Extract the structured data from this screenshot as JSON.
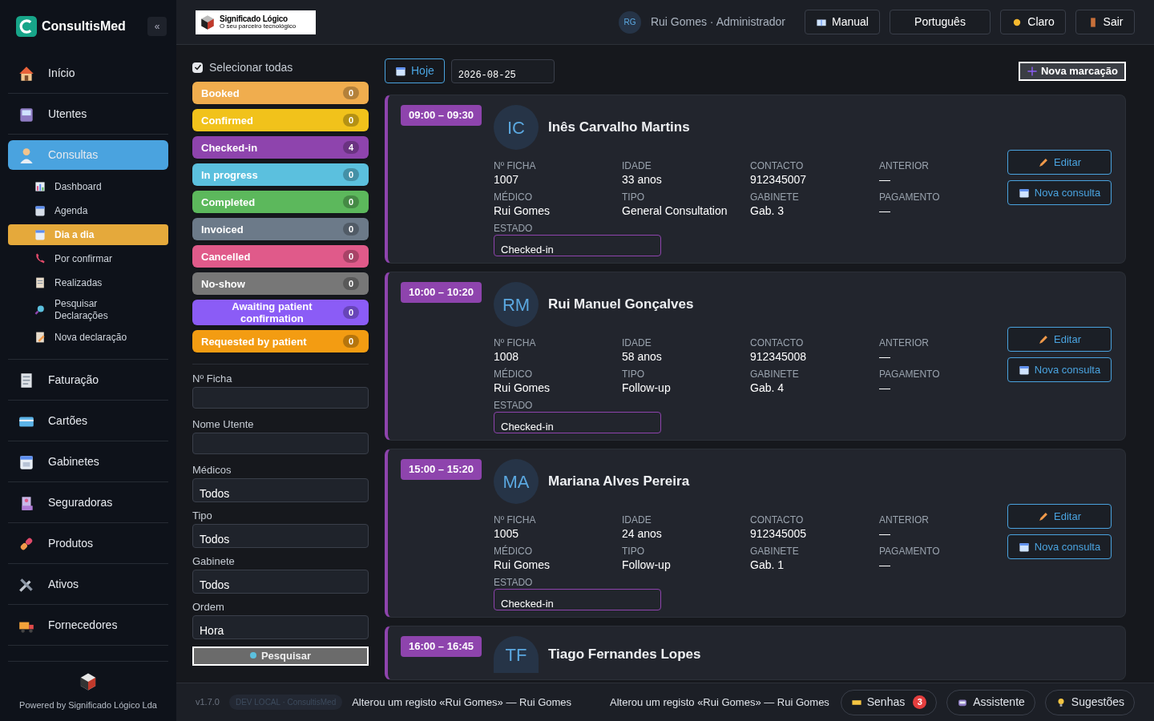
{
  "brand": {
    "name": "ConsultisMed",
    "collapse": "«"
  },
  "sidebar": {
    "items": [
      {
        "kind": "main",
        "label": "Início",
        "selected": false
      },
      {
        "kind": "main",
        "label": "Utentes",
        "selected": false
      },
      {
        "kind": "main",
        "label": "Consultas",
        "selected": true,
        "children": [
          {
            "label": "Dashboard",
            "selected": false
          },
          {
            "label": "Agenda",
            "selected": false
          },
          {
            "label": "Dia a dia",
            "selected": true
          },
          {
            "label": "Por confirmar",
            "selected": false
          },
          {
            "label": "Realizadas",
            "selected": false
          },
          {
            "label": "Pesquisar Declarações",
            "selected": false
          },
          {
            "label": "Nova declaração",
            "selected": false
          }
        ]
      },
      {
        "kind": "main",
        "label": "Faturação",
        "selected": false
      },
      {
        "kind": "main",
        "label": "Cartões",
        "selected": false
      },
      {
        "kind": "main",
        "label": "Gabinetes",
        "selected": false
      },
      {
        "kind": "main",
        "label": "Seguradoras",
        "selected": false
      },
      {
        "kind": "main",
        "label": "Produtos",
        "selected": false
      },
      {
        "kind": "main",
        "label": "Ativos",
        "selected": false
      },
      {
        "kind": "main",
        "label": "Fornecedores",
        "selected": false
      }
    ],
    "footer": "Powered by Significado Lógico Lda"
  },
  "header": {
    "logo_title": "Significado Lógico",
    "logo_tagline": "O seu parceiro tecnológico",
    "user_initials": "RG",
    "user": "Rui Gomes · Administrador",
    "buttons": [
      "Manual",
      "Português",
      "Claro",
      "Sair"
    ]
  },
  "filters": {
    "select_all": {
      "label": "Selecionar todas",
      "checked": true
    },
    "statuses": [
      {
        "label": "Booked",
        "count": "0",
        "color": "#f0ad4e"
      },
      {
        "label": "Confirmed",
        "count": "0",
        "color": "#f1c21b"
      },
      {
        "label": "Checked-in",
        "count": "4",
        "color": "#8e44ad"
      },
      {
        "label": "In progress",
        "count": "0",
        "color": "#5bc0de"
      },
      {
        "label": "Completed",
        "count": "0",
        "color": "#5cb85c"
      },
      {
        "label": "Invoiced",
        "count": "0",
        "color": "#6c7a89"
      },
      {
        "label": "Cancelled",
        "count": "0",
        "color": "#e05a8a"
      },
      {
        "label": "No-show",
        "count": "0",
        "color": "#777777"
      },
      {
        "label": "Awaiting patient confirmation",
        "count": "0",
        "color": "#8b5cf6"
      },
      {
        "label": "Requested by patient",
        "count": "0",
        "color": "#f39c12"
      }
    ],
    "fields": [
      {
        "label": "Nº Ficha",
        "kind": "input"
      },
      {
        "label": "Nome Utente",
        "kind": "input"
      },
      {
        "label": "Médicos",
        "kind": "select",
        "value": "Todos"
      },
      {
        "label": "Tipo",
        "kind": "select",
        "value": "Todos"
      },
      {
        "label": "Gabinete",
        "kind": "select",
        "value": "Todos"
      },
      {
        "label": "Ordem",
        "kind": "select",
        "value": "Hora"
      }
    ],
    "search_button": "Pesquisar"
  },
  "toolbar": {
    "today": "Hoje",
    "date": "2026-08-25",
    "new": "Nova marcação"
  },
  "appointments": [
    {
      "time": "09:00 – 09:30",
      "initials": "IC",
      "name": "Inês Carvalho Martins",
      "color": "#8e44ad",
      "fields": [
        {
          "label": "Nº FICHA",
          "value": "1007"
        },
        {
          "label": "IDADE",
          "value": "33 anos"
        },
        {
          "label": "CONTACTO",
          "value": "912345007"
        },
        {
          "label": "ANTERIOR",
          "value": "—"
        },
        {
          "label": "MÉDICO",
          "value": "Rui Gomes"
        },
        {
          "label": "TIPO",
          "value": "General Consultation"
        },
        {
          "label": "GABINETE",
          "value": "Gab. 3"
        },
        {
          "label": "PAGAMENTO",
          "value": "—"
        }
      ],
      "status_label": "ESTADO",
      "status": "Checked-in",
      "actions": [
        "Editar",
        "Nova consulta"
      ]
    },
    {
      "time": "10:00 – 10:20",
      "initials": "RM",
      "name": "Rui Manuel Gonçalves",
      "color": "#8e44ad",
      "fields": [
        {
          "label": "Nº FICHA",
          "value": "1008"
        },
        {
          "label": "IDADE",
          "value": "58 anos"
        },
        {
          "label": "CONTACTO",
          "value": "912345008"
        },
        {
          "label": "ANTERIOR",
          "value": "—"
        },
        {
          "label": "MÉDICO",
          "value": "Rui Gomes"
        },
        {
          "label": "TIPO",
          "value": "Follow-up"
        },
        {
          "label": "GABINETE",
          "value": "Gab. 4"
        },
        {
          "label": "PAGAMENTO",
          "value": "—"
        }
      ],
      "status_label": "ESTADO",
      "status": "Checked-in",
      "actions": [
        "Editar",
        "Nova consulta"
      ]
    },
    {
      "time": "15:00 – 15:20",
      "initials": "MA",
      "name": "Mariana Alves Pereira",
      "color": "#8e44ad",
      "fields": [
        {
          "label": "Nº FICHA",
          "value": "1005"
        },
        {
          "label": "IDADE",
          "value": "24 anos"
        },
        {
          "label": "CONTACTO",
          "value": "912345005"
        },
        {
          "label": "ANTERIOR",
          "value": "—"
        },
        {
          "label": "MÉDICO",
          "value": "Rui Gomes"
        },
        {
          "label": "TIPO",
          "value": "Follow-up"
        },
        {
          "label": "GABINETE",
          "value": "Gab. 1"
        },
        {
          "label": "PAGAMENTO",
          "value": "—"
        }
      ],
      "status_label": "ESTADO",
      "status": "Checked-in",
      "actions": [
        "Editar",
        "Nova consulta"
      ]
    },
    {
      "time": "16:00 – 16:45",
      "initials": "TF",
      "name": "Tiago Fernandes Lopes",
      "color": "#8e44ad"
    }
  ],
  "status_bar": {
    "version": "v1.7.0",
    "env": "DEV LOCAL · ConsultisMed",
    "activity": [
      "Alterou um registo «Rui Gomes» — Rui Gomes",
      "Alterou um registo «Rui Gomes» — Rui Gomes"
    ],
    "buttons": [
      {
        "label": "Senhas",
        "badge": "3"
      },
      {
        "label": "Assistente"
      },
      {
        "label": "Sugestões"
      }
    ]
  }
}
